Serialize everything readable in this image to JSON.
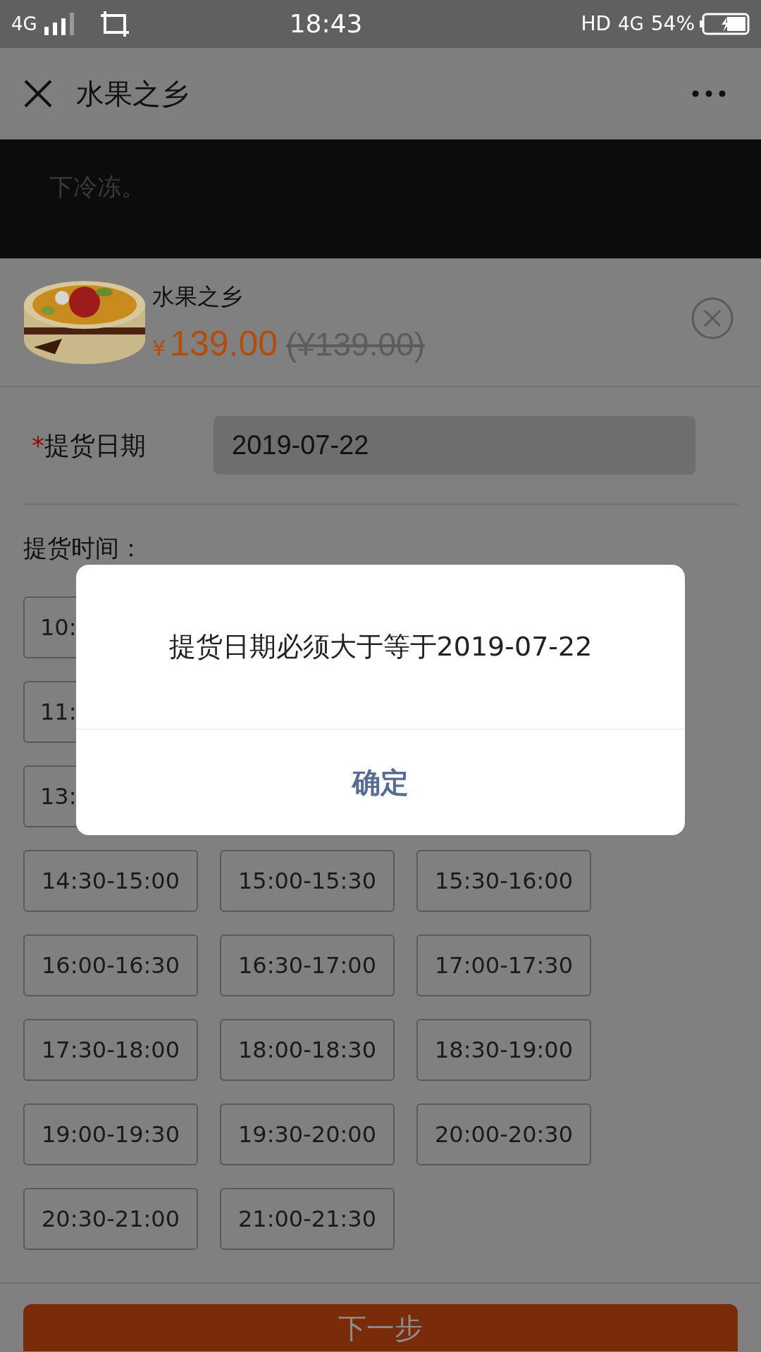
{
  "status_bar": {
    "network": "4G",
    "time": "18:43",
    "hd": "HD",
    "data_network": "4G",
    "battery": "54%"
  },
  "header": {
    "title": "水果之乡"
  },
  "background_text": "下冷冻。",
  "product": {
    "name": "水果之乡",
    "currency": "¥",
    "price": "139.00",
    "original_price": "(¥139.00)"
  },
  "date": {
    "required_mark": "*",
    "label": "提货日期",
    "value": "2019-07-22"
  },
  "time_label": "提货时间：",
  "slots": [
    {
      "label": "10:",
      "selected": false
    },
    {
      "label": "11:",
      "selected": false
    },
    {
      "label": "13:",
      "selected": false
    },
    {
      "label": "14:30-15:00",
      "selected": false
    },
    {
      "label": "15:00-15:30",
      "selected": false
    },
    {
      "label": "15:30-16:00",
      "selected": false
    },
    {
      "label": "16:00-16:30",
      "selected": false
    },
    {
      "label": "16:30-17:00",
      "selected": false
    },
    {
      "label": "17:00-17:30",
      "selected": false
    },
    {
      "label": "17:30-18:00",
      "selected": false
    },
    {
      "label": "18:00-18:30",
      "selected": false
    },
    {
      "label": "18:30-19:00",
      "selected": false
    },
    {
      "label": "19:00-19:30",
      "selected": false
    },
    {
      "label": "19:30-20:00",
      "selected": false
    },
    {
      "label": "20:00-20:30",
      "selected": false
    },
    {
      "label": "20:30-21:00",
      "selected": false
    },
    {
      "label": "21:00-21:30",
      "selected": false
    }
  ],
  "next_button": "下一步",
  "dialog": {
    "message": "提货日期必须大于等于2019-07-22",
    "confirm": "确定"
  }
}
